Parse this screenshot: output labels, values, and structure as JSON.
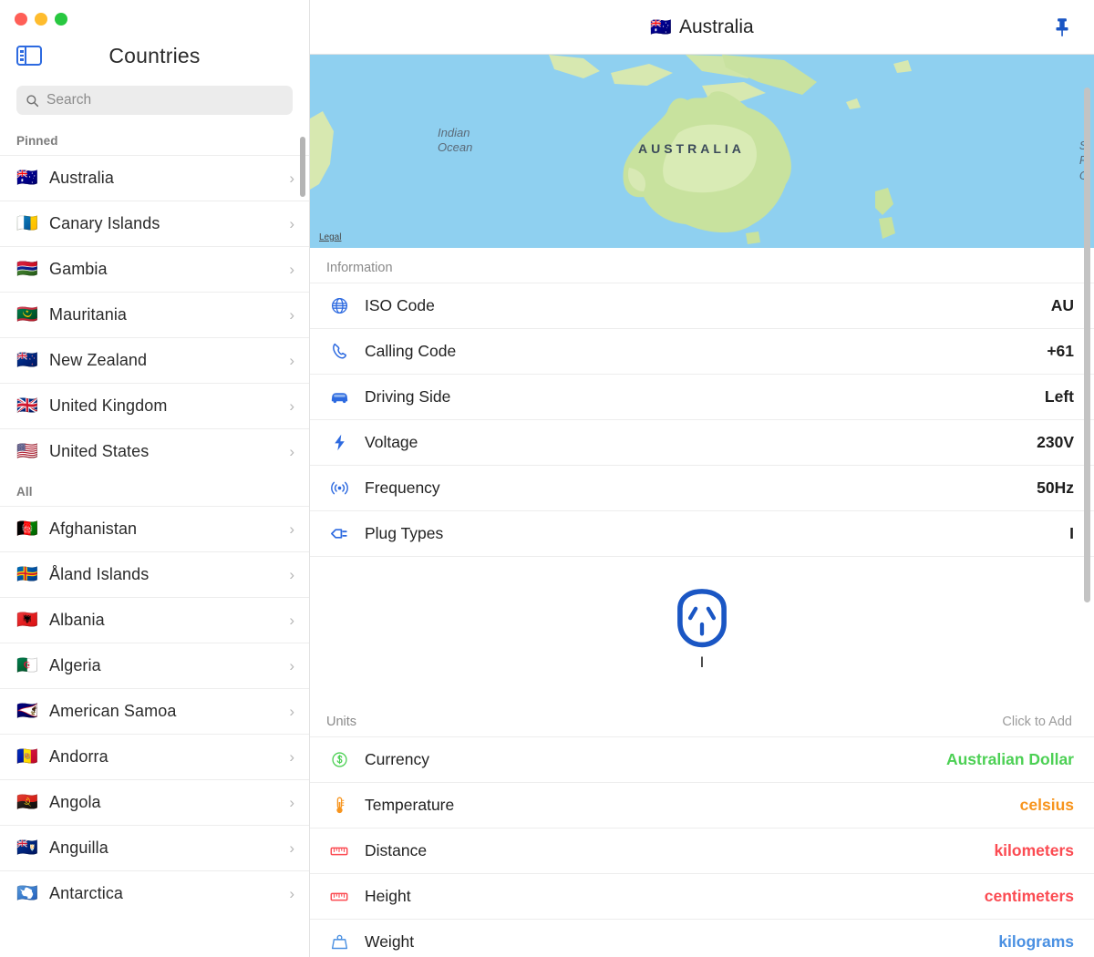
{
  "window": {
    "traffic_lights": [
      "close",
      "minimize",
      "zoom"
    ],
    "colors": {
      "close": "#ff5f57",
      "minimize": "#febc2e",
      "zoom": "#28c840"
    }
  },
  "sidebar": {
    "title": "Countries",
    "toggle_icon": "sidebar-toggle-icon",
    "search": {
      "placeholder": "Search",
      "value": "",
      "icon": "search-icon"
    },
    "groups": [
      {
        "label": "Pinned",
        "items": [
          {
            "flag": "🇦🇺",
            "name": "Australia"
          },
          {
            "flag": "🇮🇨",
            "name": "Canary Islands"
          },
          {
            "flag": "🇬🇲",
            "name": "Gambia"
          },
          {
            "flag": "🇲🇷",
            "name": "Mauritania"
          },
          {
            "flag": "🇳🇿",
            "name": "New Zealand"
          },
          {
            "flag": "🇬🇧",
            "name": "United Kingdom"
          },
          {
            "flag": "🇺🇸",
            "name": "United States"
          }
        ]
      },
      {
        "label": "All",
        "items": [
          {
            "flag": "🇦🇫",
            "name": "Afghanistan"
          },
          {
            "flag": "🇦🇽",
            "name": "Åland Islands"
          },
          {
            "flag": "🇦🇱",
            "name": "Albania"
          },
          {
            "flag": "🇩🇿",
            "name": "Algeria"
          },
          {
            "flag": "🇦🇸",
            "name": "American Samoa"
          },
          {
            "flag": "🇦🇩",
            "name": "Andorra"
          },
          {
            "flag": "🇦🇴",
            "name": "Angola"
          },
          {
            "flag": "🇦🇮",
            "name": "Anguilla"
          },
          {
            "flag": "🇦🇶",
            "name": "Antarctica"
          }
        ]
      }
    ]
  },
  "detail": {
    "header": {
      "flag": "🇦🇺",
      "title": "Australia",
      "pin_icon": "pin-icon"
    },
    "map": {
      "country_label": "AUSTRALIA",
      "ocean_labels": [
        "Indian\nOcean",
        "South\nPacific\nOcean"
      ],
      "indian_ocean": "Indian Ocean",
      "pacific_ocean": "South Pacific Ocean",
      "legal_link": "Legal",
      "water_color": "#8fd0f0",
      "land_color": "#c2e0a0"
    },
    "information": {
      "title": "Information",
      "rows": [
        {
          "icon": "globe-icon",
          "label": "ISO Code",
          "value": "AU"
        },
        {
          "icon": "phone-icon",
          "label": "Calling Code",
          "value": "+61"
        },
        {
          "icon": "car-icon",
          "label": "Driving Side",
          "value": "Left"
        },
        {
          "icon": "bolt-icon",
          "label": "Voltage",
          "value": "230V"
        },
        {
          "icon": "signal-icon",
          "label": "Frequency",
          "value": "50Hz"
        },
        {
          "icon": "plug-icon",
          "label": "Plug Types",
          "value": "I"
        }
      ],
      "plug_diagram": {
        "type_letter": "I",
        "color": "#1a56c4"
      }
    },
    "units": {
      "title": "Units",
      "action": "Click to Add",
      "rows": [
        {
          "icon": "currency-icon",
          "label": "Currency",
          "value": "Australian Dollar",
          "color": "#4cd054"
        },
        {
          "icon": "thermometer-icon",
          "label": "Temperature",
          "value": "celsius",
          "color": "#f7941d"
        },
        {
          "icon": "ruler-icon",
          "label": "Distance",
          "value": "kilometers",
          "color": "#fb4b52"
        },
        {
          "icon": "ruler-icon",
          "label": "Height",
          "value": "centimeters",
          "color": "#fb4b52"
        },
        {
          "icon": "weight-icon",
          "label": "Weight",
          "value": "kilograms",
          "color": "#4a90e2"
        }
      ]
    }
  }
}
